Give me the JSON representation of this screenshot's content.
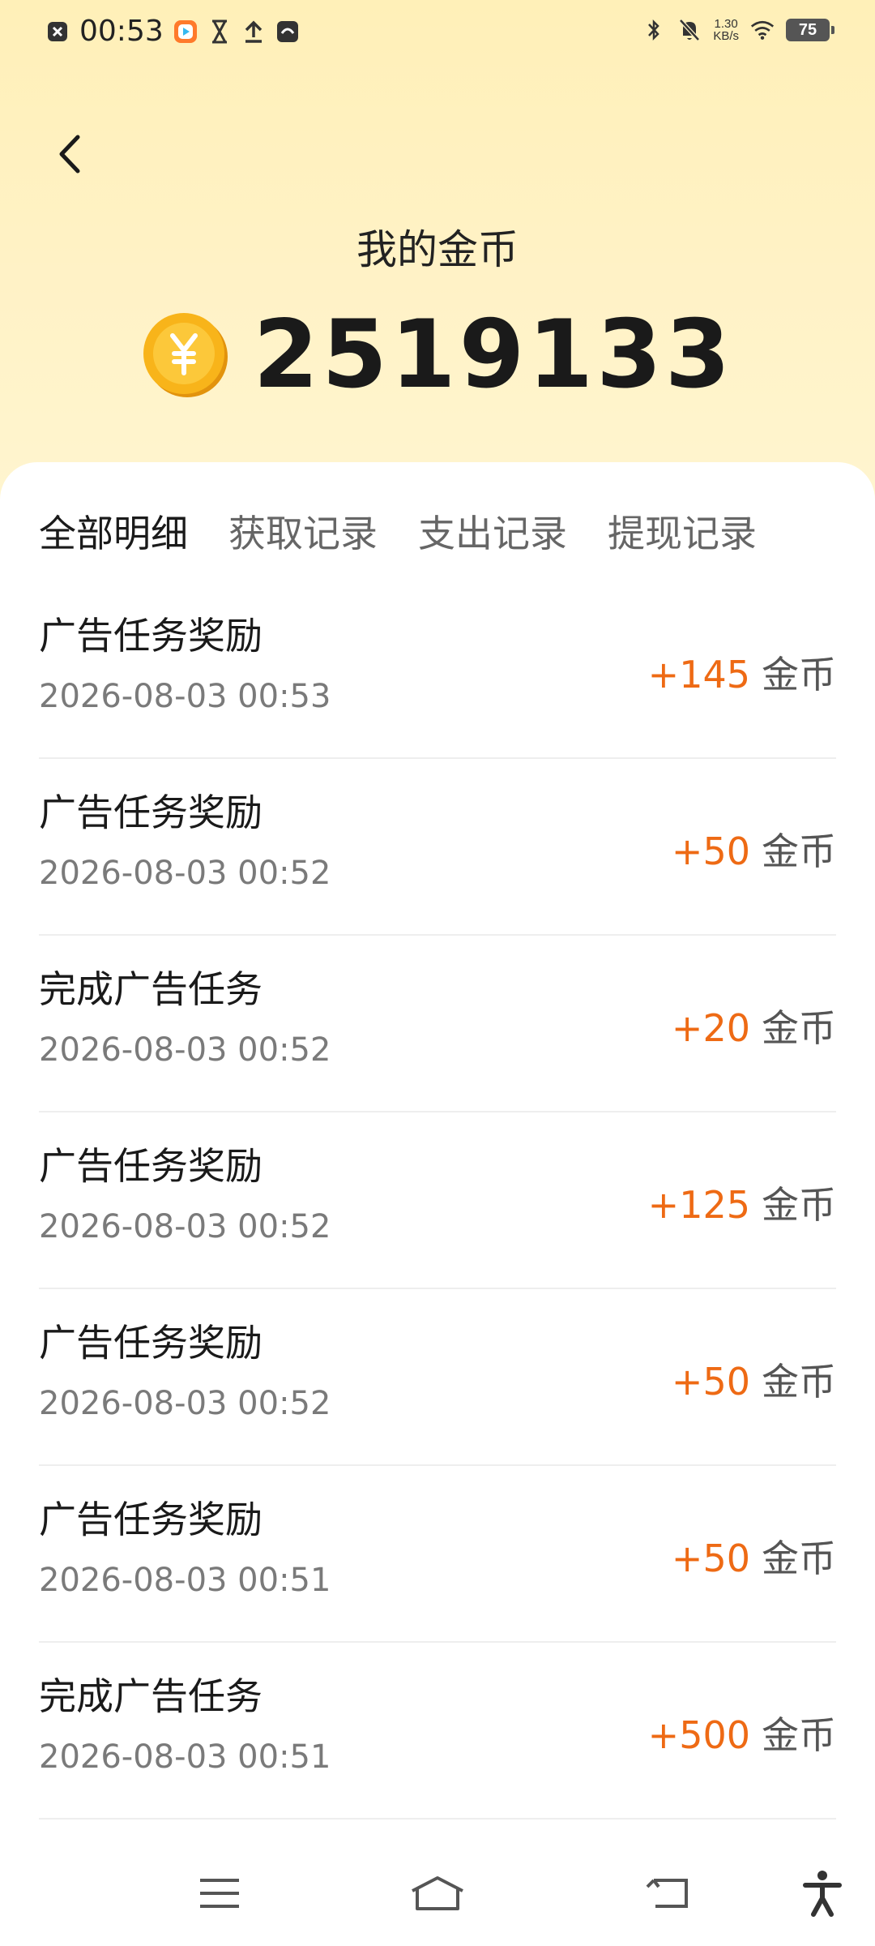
{
  "status_bar": {
    "time": "00:53",
    "net_speed_value": "1.30",
    "net_speed_unit": "KB/s",
    "battery": "75"
  },
  "header": {
    "title": "我的金币",
    "balance": "2519133"
  },
  "tabs": [
    {
      "label": "全部明细",
      "active": true
    },
    {
      "label": "获取记录",
      "active": false
    },
    {
      "label": "支出记录",
      "active": false
    },
    {
      "label": "提现记录",
      "active": false
    }
  ],
  "records": [
    {
      "title": "广告任务奖励",
      "time": "2026-08-03 00:53",
      "amount": "+145",
      "unit": "金币"
    },
    {
      "title": "广告任务奖励",
      "time": "2026-08-03 00:52",
      "amount": "+50",
      "unit": "金币"
    },
    {
      "title": "完成广告任务",
      "time": "2026-08-03 00:52",
      "amount": "+20",
      "unit": "金币"
    },
    {
      "title": "广告任务奖励",
      "time": "2026-08-03 00:52",
      "amount": "+125",
      "unit": "金币"
    },
    {
      "title": "广告任务奖励",
      "time": "2026-08-03 00:52",
      "amount": "+50",
      "unit": "金币"
    },
    {
      "title": "广告任务奖励",
      "time": "2026-08-03 00:51",
      "amount": "+50",
      "unit": "金币"
    },
    {
      "title": "完成广告任务",
      "time": "2026-08-03 00:51",
      "amount": "+500",
      "unit": "金币"
    }
  ],
  "colors": {
    "accent_amount": "#ee6a14",
    "header_bg": "#fff2c6",
    "coin": "#f6b51c"
  },
  "icons": {
    "back": "chevron-left-icon",
    "coin": "yuan-coin-icon",
    "nav_menu": "menu-icon",
    "nav_home": "home-icon",
    "nav_back": "back-arrow-icon",
    "nav_accessibility": "accessibility-icon"
  }
}
